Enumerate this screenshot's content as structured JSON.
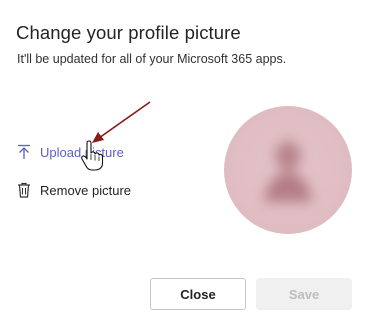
{
  "dialog": {
    "title": "Change your profile picture",
    "subtitle": "It'll be updated for all of your Microsoft 365 apps.",
    "upload_label": "Upload picture",
    "remove_label": "Remove picture",
    "upload_icon": "upload-icon",
    "remove_icon": "trash-icon",
    "accent_color": "#5b5fc7",
    "avatar_color": "#e4c5ca"
  },
  "footer": {
    "close_label": "Close",
    "save_label": "Save"
  },
  "annotation": {
    "arrow_color": "#8b1a1a"
  }
}
